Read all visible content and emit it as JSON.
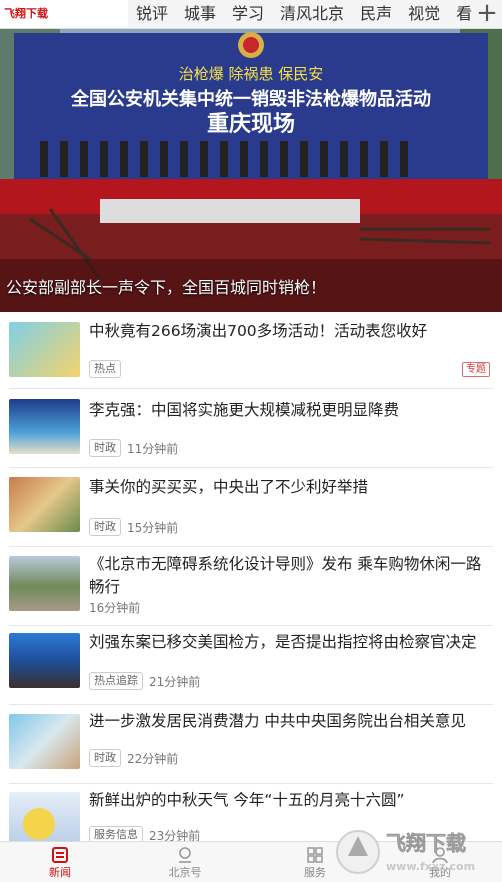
{
  "watermark_top": "飞翔下载 WWW.FXXZ.COM",
  "tabs": [
    "锐评",
    "城事",
    "学习",
    "清风北京",
    "民声",
    "视觉",
    "看("
  ],
  "hero": {
    "banner_line1": "治枪爆  除祸患  保民安",
    "banner_line2": "全国公安机关集中统一销毁非法枪爆物品活动",
    "banner_line3": "重庆现场",
    "caption": "公安部副部长一声令下，全国百城同时销枪！"
  },
  "news": [
    {
      "title": "中秋竟有266场演出700多场活动！活动表您收好",
      "tag": "热点",
      "time": "",
      "special": "专题",
      "thumb": "mid-autumn"
    },
    {
      "title": "李克强：中国将实施更大规模减税更明显降费",
      "tag": "时政",
      "time": "11分钟前",
      "thumb": "forum"
    },
    {
      "title": "事关你的买买买，中央出了不少利好举措",
      "tag": "时政",
      "time": "15分钟前",
      "thumb": "market"
    },
    {
      "title": "《北京市无障碍系统化设计导则》发布  乘车购物休闲一路畅行",
      "tag": "",
      "time": "16分钟前",
      "thumb": "street"
    },
    {
      "title": "刘强东案已移交美国检方，是否提出指控将由检察官决定",
      "tag": "热点追踪",
      "time": "21分钟前",
      "thumb": "person"
    },
    {
      "title": "进一步激发居民消费潜力  中共中央国务院出台相关意见",
      "tag": "时政",
      "time": "22分钟前",
      "thumb": "bag"
    },
    {
      "title": "新鲜出炉的中秋天气  今年“十五的月亮十六圆”",
      "tag": "服务信息",
      "time": "23分钟前",
      "thumb": "weather"
    }
  ],
  "bottom_tabs": [
    {
      "label": "新闻",
      "icon": "news-icon",
      "active": true
    },
    {
      "label": "北京号",
      "icon": "location-icon",
      "active": false
    },
    {
      "label": "服务",
      "icon": "grid-icon",
      "active": false
    },
    {
      "label": "我的",
      "icon": "user-icon",
      "active": false
    }
  ],
  "watermark_bottom": {
    "brand": "飞翔下载",
    "url": "www.fxxz.com"
  },
  "colors": {
    "accent": "#d01010",
    "hero_banner": "#2a3a8c"
  }
}
